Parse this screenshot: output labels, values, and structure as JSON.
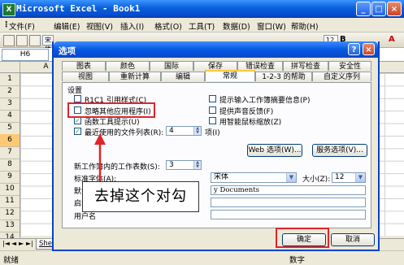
{
  "excel": {
    "app_icon": "excel-icon",
    "title": "Microsoft Excel - Book1",
    "window_buttons": [
      "_",
      "□",
      "×"
    ],
    "menu": [
      "文件(F)",
      "编辑(E)",
      "视图(V)",
      "插入(I)",
      "格式(O)",
      "工具(T)",
      "数据(D)",
      "窗口(W)",
      "帮助(H)"
    ],
    "toolbar": {
      "font_name": "宋体",
      "font_size": "12",
      "bold": "B",
      "italic": "I",
      "underline": "U"
    },
    "name_box": "H6",
    "columns": [
      "A"
    ],
    "rows": [
      "1",
      "2",
      "3",
      "4",
      "5",
      "6",
      "7",
      "8",
      "9",
      "10",
      "11",
      "12",
      "13",
      "14"
    ],
    "sheet_tab": "She",
    "sheet_nav": [
      "|◄",
      "◄",
      "►",
      "►|"
    ],
    "status_left": "就绪",
    "status_right": "数字"
  },
  "dialog": {
    "title": "选项",
    "help": "?",
    "close": "×",
    "tabs_row1": [
      "图表",
      "颜色",
      "国际",
      "保存",
      "错误检查",
      "拼写检查",
      "安全性"
    ],
    "tabs_row2": [
      "视图",
      "重新计算",
      "编辑",
      "常规",
      "1-2-3 的帮助",
      "自定义序列"
    ],
    "active_tab": "常规",
    "section_title": "设置",
    "left_options": [
      {
        "label": "R1C1 引用样式(C)",
        "checked": false
      },
      {
        "label": "忽略其他应用程序(I)",
        "checked": false
      },
      {
        "label": "函数工具提示(U)",
        "checked": true
      },
      {
        "label": "最近使用的文件列表(R):",
        "checked": true
      }
    ],
    "recent_count": "4",
    "recent_unit": "项(I)",
    "right_options": [
      {
        "label": "提示输入工作簿摘要信息(P)",
        "checked": false
      },
      {
        "label": "提供声音反馈(F)",
        "checked": false
      },
      {
        "label": "用智能鼠标缩放(Z)",
        "checked": false
      }
    ],
    "web_button": "Web 选项(W)...",
    "service_button": "服务选项(V)...",
    "sheets_label": "新工作簿内的工作表数(S):",
    "sheets_value": "3",
    "std_font_label": "标准字体(A):",
    "std_font_value": "宋体",
    "size_label": "大小(Z):",
    "size_value": "12",
    "default_path_label": "默认文件",
    "default_path_value": "y Documents",
    "startup_label": "启动时打",
    "user_label": "用户名",
    "ok": "确定",
    "cancel": "取消"
  },
  "annotation": {
    "callout_text": "去掉这个对勾",
    "highlight_color": "#e0242b"
  }
}
